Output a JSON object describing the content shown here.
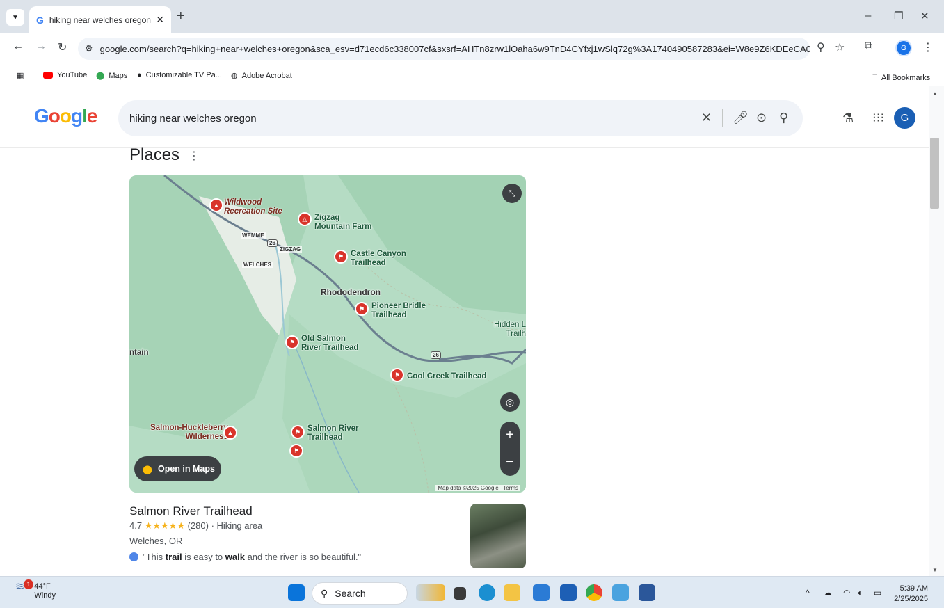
{
  "browser": {
    "tab_title": "hiking near welches oregon - G",
    "url": "google.com/search?q=hiking+near+welches+oregon&sca_esv=d71ecd6c338007cf&sxsrf=AHTn8zrw1lOaha6w9TnD4CYfxj1wSlq72g%3A1740490587283&ei=W8e9Z6KDEeCA0PEPsJ7YOA...",
    "profile_initial": "G",
    "bookmarks": [
      "YouTube",
      "Maps",
      "Customizable TV Pa...",
      "Adobe Acrobat"
    ],
    "all_bookmarks_label": "All Bookmarks"
  },
  "google": {
    "logo": "Google",
    "query": "hiking near welches oregon",
    "avatar_initial": "G"
  },
  "places": {
    "title": "Places",
    "map": {
      "labels": {
        "wildwood": "Wildwood\nRecreation Site",
        "zigzag_farm": "Zigzag\nMountain Farm",
        "castle": "Castle Canyon\nTrailhead",
        "rhododendron": "Rhododendron",
        "pioneer": "Pioneer Bridle\nTrailhead",
        "hidden": "Hidden L\nTrailh",
        "old_salmon": "Old Salmon\nRiver Trailhead",
        "ntain": "ntain",
        "cool_creek": "Cool Creek Trailhead",
        "salmon_huck": "Salmon-Huckleberry\nWilderness",
        "salmon_river": "Salmon River\nTrailhead",
        "wemme": "WEMME",
        "zigzag_town": "ZIGZAG",
        "welches": "WELCHES",
        "hwy1": "26",
        "hwy2": "26"
      },
      "open_in_maps": "Open in Maps",
      "credit": "Map data ©2025 Google",
      "terms": "Terms"
    },
    "result": {
      "title": "Salmon River Trailhead",
      "rating": "4.7",
      "stars": "★★★★★",
      "rating_value": 4.7,
      "reviews": "(280)",
      "category": "· Hiking area",
      "location": "Welches, OR",
      "review_pre": "\"This ",
      "review_b1": "trail",
      "review_mid": " is easy to ",
      "review_b2": "walk",
      "review_post": " and the river is so beautiful.\""
    }
  },
  "taskbar": {
    "temp": "44°F",
    "condition": "Windy",
    "badge": "1",
    "search": "Search",
    "time": "5:39 AM",
    "date": "2/25/2025"
  }
}
